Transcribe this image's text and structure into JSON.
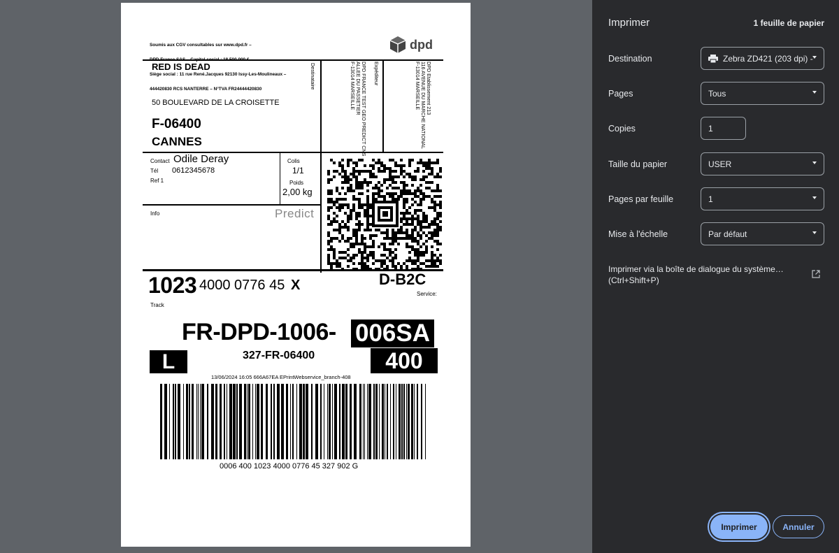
{
  "label": {
    "legal_lines": [
      "Soumis aux CGV consultables sur www.dpd.fr –",
      "DPD France SAS – Capital social : 18 500 000 € –",
      "Siège social : 11 rue René.Jacques 92130 Issy-Les-Moulineaux –",
      "444420830 RCS NANTERRE – N°TVA FR24444420830"
    ],
    "logo_text": "dpd",
    "recipient": {
      "name": "RED IS DEAD",
      "address": "50 BOULEVARD DE LA CROISETTE",
      "zip": "F-06400",
      "city": "CANNES",
      "label": "Destinataire"
    },
    "sender": {
      "label": "Expéditeur",
      "lines": "DPD FRANCE TEST GEO PREDICT CNS\nALLEE DU PASSETIER\nF-13014 MARSEILLE"
    },
    "depot": {
      "lines": "DPD Etablissement 213\n116 AVENUE DU MARCHE NATIONAL\nF-13014 MARSEILLE"
    },
    "contact_label": "Contact",
    "contact_value": "Odile Deray",
    "tel_label": "Tél",
    "tel_value": "0612345678",
    "ref_label": "Ref 1",
    "colis_label": "Colis",
    "colis_value": "1/1",
    "poids_label": "Poids",
    "poids_value": "2,00 kg",
    "info_label": "Info",
    "predict_text": "Predict",
    "tracking_bold": "1023",
    "tracking_rest": "4000 0776 45",
    "tracking_x": "X",
    "track_label": "Track",
    "service_code": "D-B2C",
    "service_label": "Service:",
    "route_main": "FR-DPD-1006-",
    "route_box": "006SA",
    "route_l": "L",
    "route_sub": "327-FR-06400",
    "route_400": "400",
    "stamp": "13/06/2024 16:05 666A67EA EPrintWebservice_branch-408",
    "barcode_text": "0006 400 1023 4000 0776 45 327 902 G"
  },
  "panel": {
    "title": "Imprimer",
    "sheets": "1 feuille de papier",
    "destination_label": "Destination",
    "destination_value": "Zebra ZD421 (203 dpi) -",
    "pages_label": "Pages",
    "pages_value": "Tous",
    "copies_label": "Copies",
    "copies_value": "1",
    "paper_label": "Taille du papier",
    "paper_value": "USER",
    "per_sheet_label": "Pages par feuille",
    "per_sheet_value": "1",
    "scale_label": "Mise à l'échelle",
    "scale_value": "Par défaut",
    "system_dialog_line1": "Imprimer via la boîte de dialogue du système…",
    "system_dialog_line2": "(Ctrl+Shift+P)",
    "print_button": "Imprimer",
    "cancel_button": "Annuler",
    "accent_color": "#8ab4f8"
  }
}
